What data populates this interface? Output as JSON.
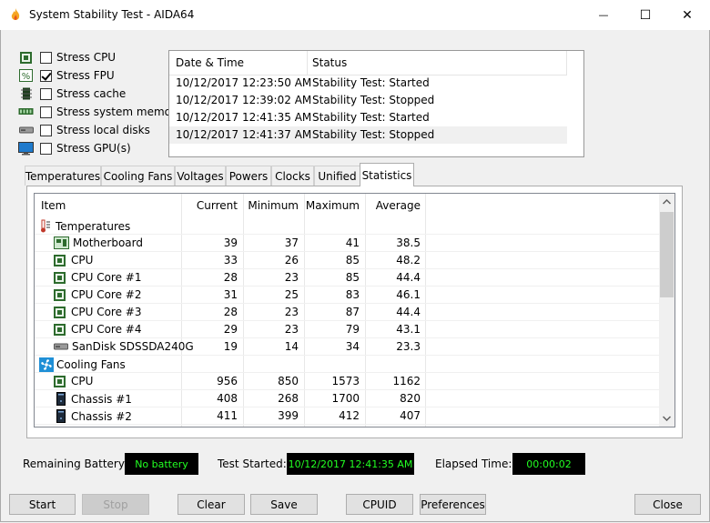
{
  "window": {
    "title": "System Stability Test - AIDA64",
    "minimize_glyph": "—",
    "maximize_glyph": "☐",
    "close_glyph": "✕"
  },
  "stress": [
    {
      "label": "Stress CPU",
      "checked": false,
      "icon": "cpu-chip-icon"
    },
    {
      "label": "Stress FPU",
      "checked": true,
      "icon": "fpu-icon"
    },
    {
      "label": "Stress cache",
      "checked": false,
      "icon": "cache-icon"
    },
    {
      "label": "Stress system memory",
      "checked": false,
      "icon": "memory-icon"
    },
    {
      "label": "Stress local disks",
      "checked": false,
      "icon": "disk-icon"
    },
    {
      "label": "Stress GPU(s)",
      "checked": false,
      "icon": "monitor-icon"
    }
  ],
  "log": {
    "headers": {
      "datetime": "Date & Time",
      "status": "Status"
    },
    "rows": [
      {
        "datetime": "10/12/2017 12:23:50 AM",
        "status": "Stability Test: Started"
      },
      {
        "datetime": "10/12/2017 12:39:02 AM",
        "status": "Stability Test: Stopped"
      },
      {
        "datetime": "10/12/2017 12:41:35 AM",
        "status": "Stability Test: Started"
      },
      {
        "datetime": "10/12/2017 12:41:37 AM",
        "status": "Stability Test: Stopped"
      }
    ]
  },
  "tabs": [
    "Temperatures",
    "Cooling Fans",
    "Voltages",
    "Powers",
    "Clocks",
    "Unified",
    "Statistics"
  ],
  "active_tab": "Statistics",
  "stats": {
    "headers": {
      "item": "Item",
      "current": "Current",
      "minimum": "Minimum",
      "maximum": "Maximum",
      "average": "Average"
    },
    "rows": [
      {
        "type": "group",
        "name": "Temperatures",
        "icon": "thermometer-icon"
      },
      {
        "type": "item",
        "name": "Motherboard",
        "icon": "motherboard-icon",
        "current": "39",
        "minimum": "37",
        "maximum": "41",
        "average": "38.5"
      },
      {
        "type": "item",
        "name": "CPU",
        "icon": "cpu-chip-icon",
        "current": "33",
        "minimum": "26",
        "maximum": "85",
        "average": "48.2"
      },
      {
        "type": "item",
        "name": "CPU Core #1",
        "icon": "cpu-chip-icon",
        "current": "28",
        "minimum": "23",
        "maximum": "85",
        "average": "44.4"
      },
      {
        "type": "item",
        "name": "CPU Core #2",
        "icon": "cpu-chip-icon",
        "current": "31",
        "minimum": "25",
        "maximum": "83",
        "average": "46.1"
      },
      {
        "type": "item",
        "name": "CPU Core #3",
        "icon": "cpu-chip-icon",
        "current": "28",
        "minimum": "23",
        "maximum": "87",
        "average": "44.4"
      },
      {
        "type": "item",
        "name": "CPU Core #4",
        "icon": "cpu-chip-icon",
        "current": "29",
        "minimum": "23",
        "maximum": "79",
        "average": "43.1"
      },
      {
        "type": "item",
        "name": "SanDisk SDSSDA240G",
        "icon": "disk-icon",
        "current": "19",
        "minimum": "14",
        "maximum": "34",
        "average": "23.3"
      },
      {
        "type": "group",
        "name": "Cooling Fans",
        "icon": "fan-icon"
      },
      {
        "type": "item",
        "name": "CPU",
        "icon": "cpu-chip-icon",
        "current": "956",
        "minimum": "850",
        "maximum": "1573",
        "average": "1162"
      },
      {
        "type": "item",
        "name": "Chassis #1",
        "icon": "chassis-icon",
        "current": "408",
        "minimum": "268",
        "maximum": "1700",
        "average": "820"
      },
      {
        "type": "item",
        "name": "Chassis #2",
        "icon": "chassis-icon",
        "current": "411",
        "minimum": "399",
        "maximum": "412",
        "average": "407"
      }
    ]
  },
  "status": {
    "battery_label": "Remaining Battery:",
    "battery_value": "No battery",
    "started_label": "Test Started:",
    "started_value": "10/12/2017 12:41:35 AM",
    "elapsed_label": "Elapsed Time:",
    "elapsed_value": "00:00:02"
  },
  "buttons": {
    "start": "Start",
    "stop": "Stop",
    "clear": "Clear",
    "save": "Save",
    "cpuid": "CPUID",
    "preferences": "Preferences",
    "close": "Close"
  },
  "colors": {
    "lcd_text": "#22ff22",
    "lcd_bg": "#000000",
    "app_icon": "#f5a623"
  }
}
